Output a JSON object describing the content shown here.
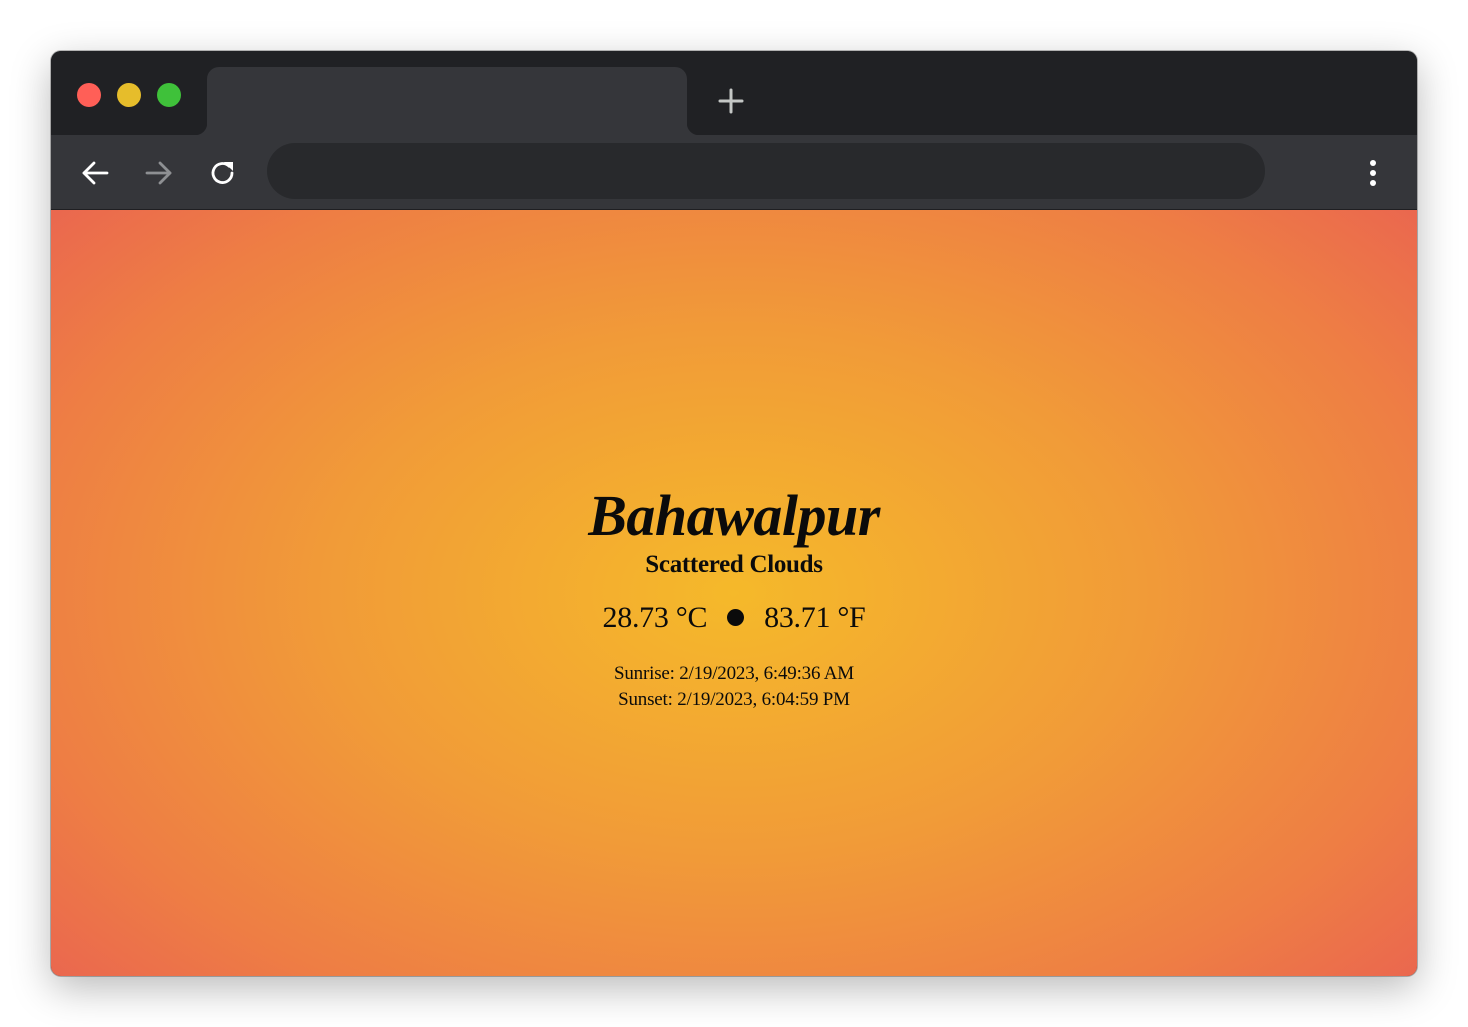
{
  "browser": {
    "tab_title": "",
    "address": "",
    "colors": {
      "titlebar": "#202124",
      "toolbar": "#35363a",
      "omnibox": "#28292c"
    }
  },
  "icons": {
    "close": "red-traffic-light",
    "minimize": "yellow-traffic-light",
    "maximize": "green-traffic-light",
    "new_tab": "plus-icon",
    "back": "arrow-left-icon",
    "forward": "arrow-right-icon",
    "reload": "reload-icon",
    "menu": "kebab-menu-icon"
  },
  "weather": {
    "city": "Bahawalpur",
    "description": "Scattered Clouds",
    "temp_c": "28.73 °C",
    "temp_f": "83.71 °F",
    "sunrise": "Sunrise: 2/19/2023, 6:49:36 AM",
    "sunset": "Sunset: 2/19/2023, 6:04:59 PM"
  },
  "background": {
    "center_color": "#f5b92a",
    "edge_color": "#e85a55"
  }
}
